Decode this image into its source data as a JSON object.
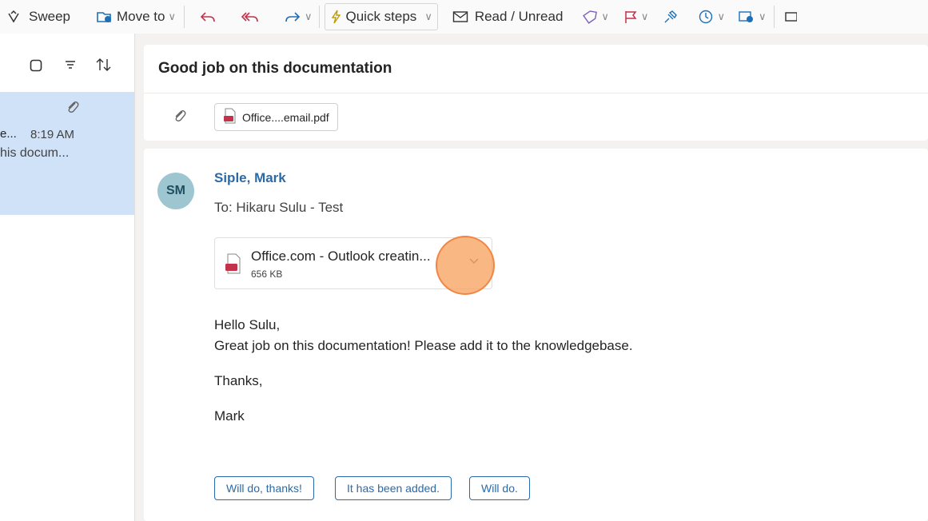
{
  "toolbar": {
    "sweep": "Sweep",
    "move_to": "Move to",
    "quick_steps": "Quick steps",
    "read_unread": "Read / Unread"
  },
  "message_list": {
    "selected": {
      "sender": "e...",
      "time": "8:19 AM",
      "preview": "his docum..."
    }
  },
  "reading_pane": {
    "subject": "Good job on this documentation",
    "header_attachment": "Office....email.pdf",
    "message": {
      "avatar_initials": "SM",
      "from": "Siple, Mark",
      "to": "To: Hikaru Sulu - Test",
      "attachment": {
        "name": "Office.com - Outlook creatin...",
        "size": "656 KB"
      },
      "body": {
        "greeting": "Hello Sulu,",
        "line1": "Great job on this documentation! Please add it to the knowledgebase.",
        "closing": "Thanks,",
        "signature": "Mark"
      },
      "quick_replies": [
        "Will do, thanks!",
        "It has been added.",
        "Will do."
      ]
    }
  },
  "colors": {
    "accent": "#2b6aa8",
    "selected_item": "#d0e2f8",
    "avatar": "#9dc6d1",
    "pdf_red": "#c4314b",
    "click_highlight": "#f7a360"
  }
}
